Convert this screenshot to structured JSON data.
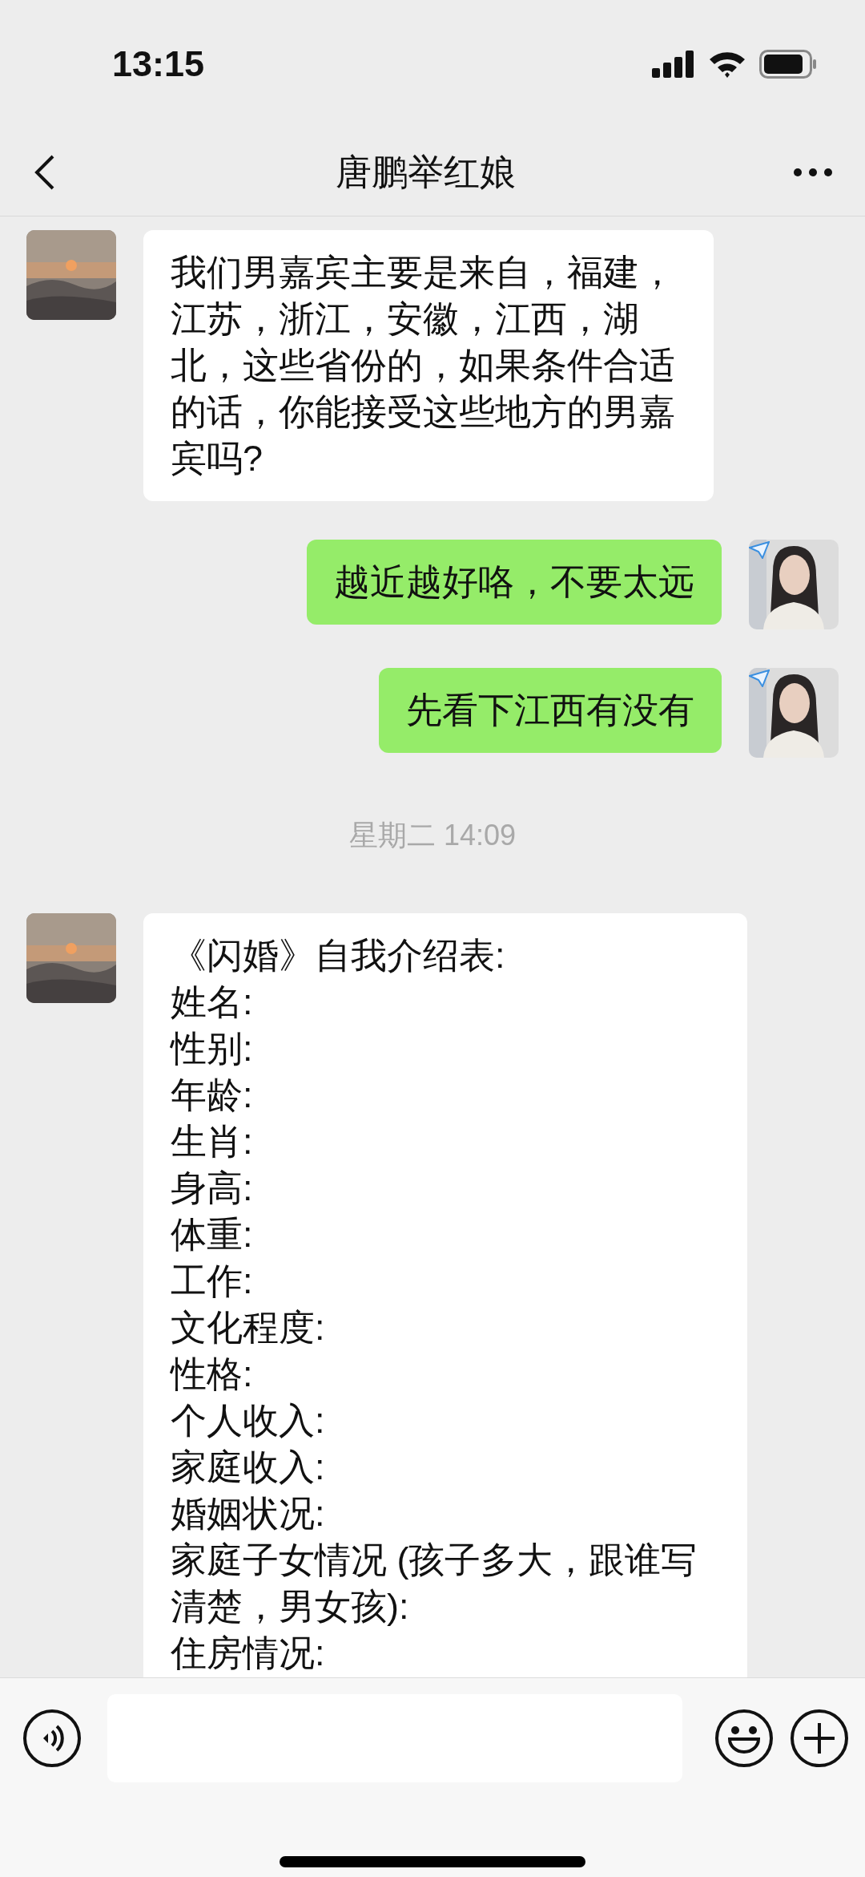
{
  "status_bar": {
    "time": "13:15"
  },
  "nav": {
    "title": "唐鹏举红娘"
  },
  "messages": [
    {
      "kind": "text",
      "outgoing": false,
      "text": "我们男嘉宾主要是来自，福建，江苏，浙江，安徽，江西，湖北，这些省份的，如果条件合适的话，你能接受这些地方的男嘉宾吗?"
    },
    {
      "kind": "text",
      "outgoing": true,
      "text": "越近越好咯，不要太远"
    },
    {
      "kind": "text",
      "outgoing": true,
      "text": "先看下江西有没有"
    },
    {
      "kind": "time",
      "text": "星期二 14:09"
    },
    {
      "kind": "text",
      "outgoing": false,
      "text": "《闪婚》自我介绍表:\n姓名:\n性别:\n年龄:\n生肖:\n身高:\n体重:\n工作:\n文化程度:\n性格:\n个人收入:\n家庭收入:\n婚姻状况:\n家庭子女情况 (孩子多大，跟谁写清楚，男女孩):\n住房情况:"
    }
  ]
}
